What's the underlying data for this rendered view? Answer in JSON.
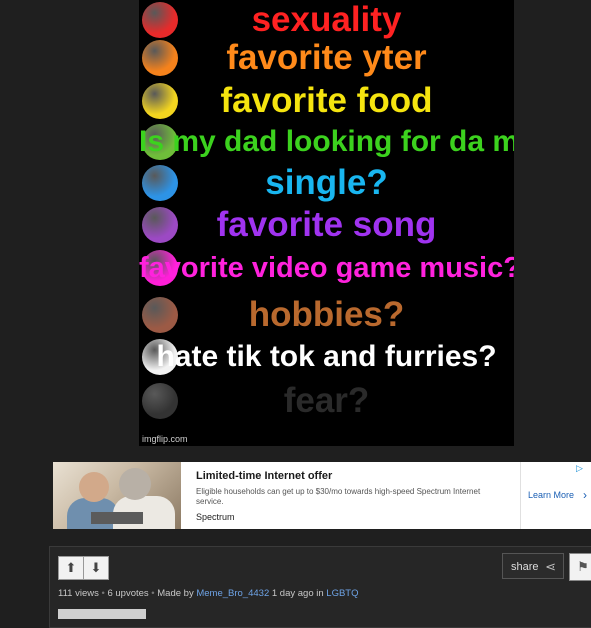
{
  "meme": {
    "rows": [
      {
        "text": "sexuality",
        "color": "#ff2222",
        "circle": "#e82a2a"
      },
      {
        "text": "favorite yter",
        "color": "#ff8a1a",
        "circle": "#f5821c"
      },
      {
        "text": "favorite food",
        "color": "#f5e40f",
        "circle": "#f3d51f"
      },
      {
        "text": "Is my dad looking for da milk",
        "color": "#3cd21e",
        "circle": "#6fbd3a"
      },
      {
        "text": "single?",
        "color": "#19b6f0",
        "circle": "#2d93e6"
      },
      {
        "text": "favorite song",
        "color": "#a033f0",
        "circle": "#9c49c4"
      },
      {
        "text": "favorite video game music?",
        "color": "#ff22dd",
        "circle": "#ff1fd8"
      },
      {
        "text": "hobbies?",
        "color": "#b9692e",
        "circle": "#9c5a45"
      },
      {
        "text": "hate tik tok and furries?",
        "color": "#ffffff",
        "circle": "#f2f2f2"
      },
      {
        "text": "fear?",
        "color": "#2a2a2a",
        "circle": "#333333"
      }
    ],
    "watermark": "imgflip.com"
  },
  "ad": {
    "headline": "Limited-time Internet offer",
    "body": "Eligible households can get up to $30/mo towards high-speed Spectrum Internet service.",
    "brand": "Spectrum",
    "cta": "Learn More",
    "cta_icon": "chevron-right-icon",
    "choices_icon": "adchoices-icon"
  },
  "post": {
    "upvote_icon": "arrow-up-icon",
    "downvote_icon": "arrow-down-icon",
    "share_label": "share",
    "views": "111 views",
    "upvotes": "6 upvotes",
    "made_by_prefix": "Made by",
    "author": "Meme_Bro_4432",
    "time": "1 day ago in",
    "stream": "LGBTQ",
    "flag_icon": "flag-icon"
  }
}
